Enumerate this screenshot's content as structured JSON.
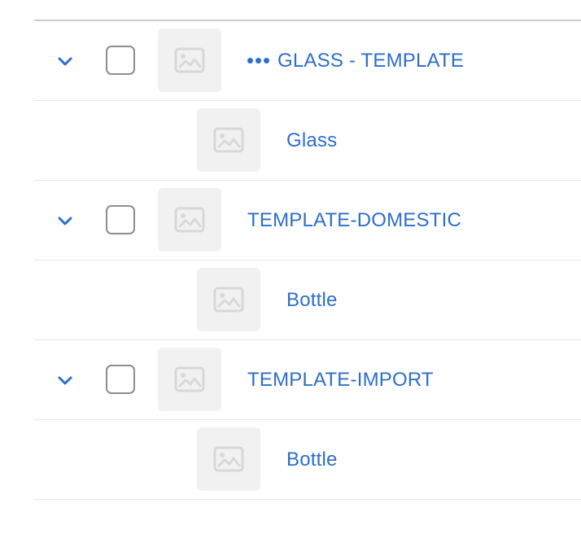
{
  "colors": {
    "accent": "#2c6ecb",
    "divider": "#e6e7e9",
    "checkbox_border": "#8a8d91",
    "thumb_bg": "#f1f1f1"
  },
  "rows": [
    {
      "level": "parent",
      "title": "GLASS - TEMPLATE",
      "has_menu_dots": true,
      "checked": false,
      "icon": "image-placeholder-icon"
    },
    {
      "level": "child",
      "title": "Glass",
      "icon": "image-placeholder-icon"
    },
    {
      "level": "parent",
      "title": "TEMPLATE-DOMESTIC",
      "has_menu_dots": false,
      "checked": false,
      "icon": "image-placeholder-icon"
    },
    {
      "level": "child",
      "title": "Bottle",
      "icon": "image-placeholder-icon"
    },
    {
      "level": "parent",
      "title": "TEMPLATE-IMPORT",
      "has_menu_dots": false,
      "checked": false,
      "icon": "image-placeholder-icon"
    },
    {
      "level": "child",
      "title": "Bottle",
      "icon": "image-placeholder-icon"
    }
  ]
}
